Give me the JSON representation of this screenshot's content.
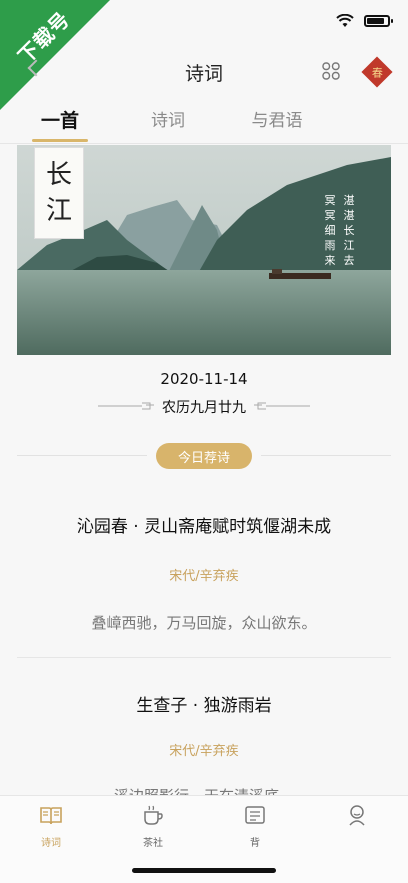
{
  "watermark": {
    "text": "下载号"
  },
  "status_bar": {
    "battery_level": 0.85
  },
  "nav": {
    "title": "诗词"
  },
  "spring_badge": {
    "text": "春"
  },
  "tabs": [
    {
      "label": "一首",
      "active": true
    },
    {
      "label": "诗词",
      "active": false
    },
    {
      "label": "与君语",
      "active": false
    }
  ],
  "banner": {
    "tag": [
      "长",
      "江"
    ],
    "poem_columns": [
      "湛湛长江去",
      "冥冥细雨来"
    ]
  },
  "date": "2020-11-14",
  "lunar": "农历九月廿九",
  "recommend_label": "今日荐诗",
  "poems": [
    {
      "title": "沁园春 · 灵山斋庵赋时筑偃湖未成",
      "author": "宋代/辛弃疾",
      "line": "叠嶂西驰，万马回旋，众山欲东。"
    },
    {
      "title": "生查子 · 独游雨岩",
      "author": "宋代/辛弃疾",
      "line": "溪边照影行，天在清溪底。"
    }
  ],
  "tab_bar": [
    {
      "label": "诗词",
      "icon": "book-icon",
      "active": true
    },
    {
      "label": "茶社",
      "icon": "tea-cup-icon",
      "active": false
    },
    {
      "label": "背",
      "icon": "recite-icon",
      "active": false
    },
    {
      "label": "",
      "icon": "profile-icon",
      "active": false
    }
  ],
  "colors": {
    "accent": "#d8b46b",
    "author": "#c8a25d",
    "watermark": "#2e9d4a",
    "spring": "#c0392b"
  }
}
